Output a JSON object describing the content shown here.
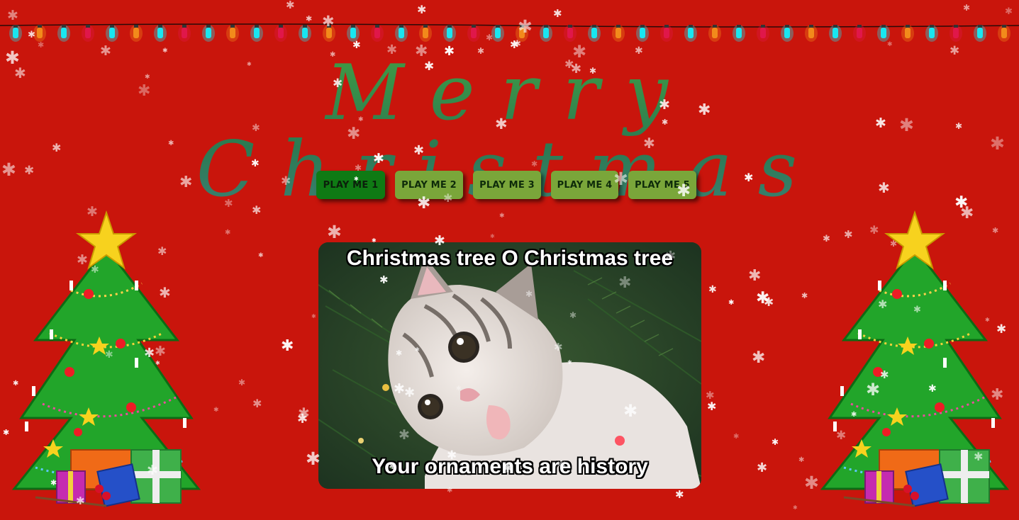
{
  "page": {
    "title": "Merry Christmas"
  },
  "buttons": [
    {
      "label": "PLAY ME 1",
      "active": true
    },
    {
      "label": "PLAY ME 2",
      "active": false
    },
    {
      "label": "PLAY ME 3",
      "active": false
    },
    {
      "label": "PLAY ME 4",
      "active": false
    },
    {
      "label": "PLAY ME 5",
      "active": false
    }
  ],
  "meme": {
    "top_caption": "Christmas tree O Christmas tree",
    "bottom_caption": "Your ornaments are history"
  },
  "colors": {
    "background": "#c9150c",
    "button": "#7aa63a",
    "button_active": "#0f7a14",
    "title": "#3f9a45"
  },
  "icons": {
    "lights": "string-lights-icon",
    "tree": "christmas-tree-icon",
    "snow": "snowflake-icon"
  }
}
